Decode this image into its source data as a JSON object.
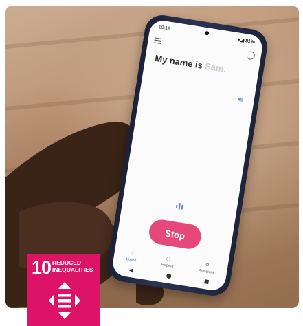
{
  "phone": {
    "status_time": "10:19",
    "status_battery": "81%",
    "headline_prefix": "My name is",
    "headline_ghost": "Sam.",
    "stop_label": "Stop",
    "nav": [
      {
        "label": "Listen",
        "icon": "listen-icon"
      },
      {
        "label": "Repeat",
        "icon": "repeat-icon"
      },
      {
        "label": "Assistant",
        "icon": "assistant-icon"
      }
    ],
    "accent": "#4b6fd8",
    "stop_color": "#e6487a"
  },
  "badge": {
    "number": "10",
    "line1": "REDUCED",
    "line2": "INEQUALITIES",
    "color": "#dd1367",
    "icon": "equality-arrows-icon"
  }
}
